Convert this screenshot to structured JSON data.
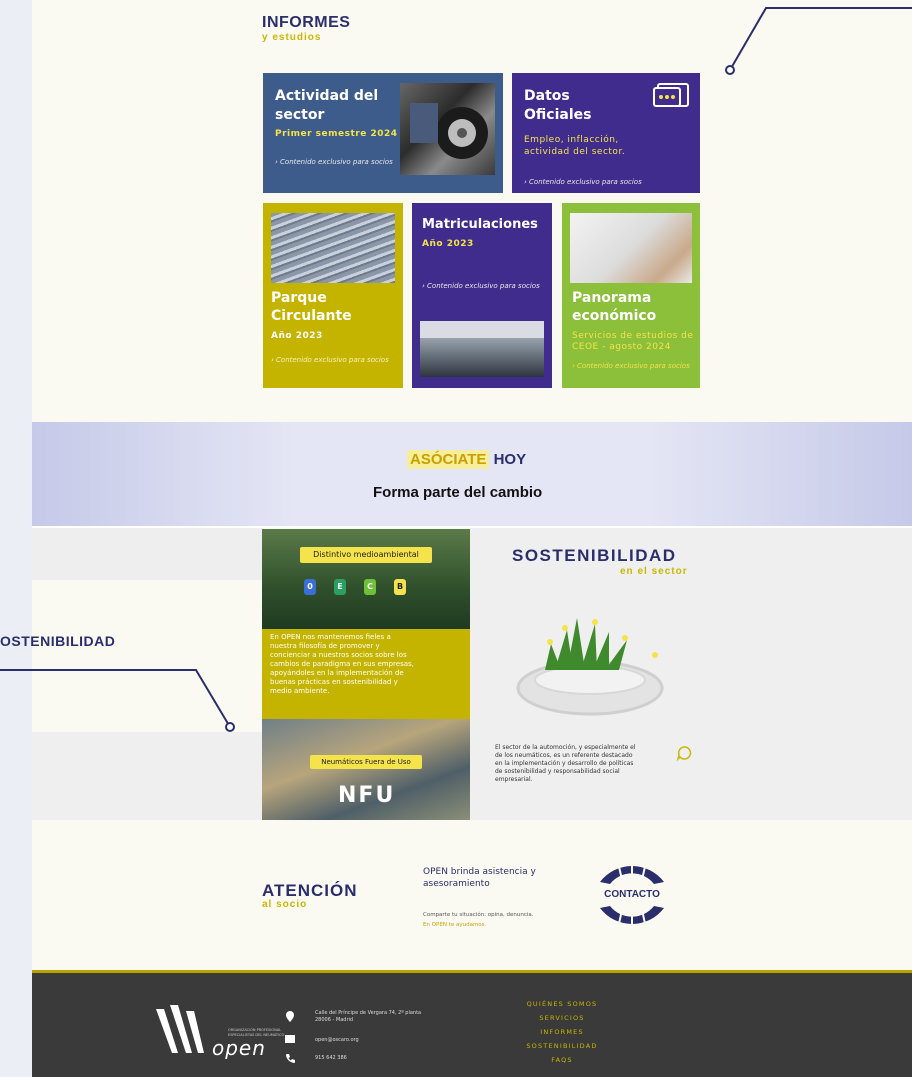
{
  "informes": {
    "title": "INFORMES",
    "subtitle": "y estudios",
    "cards": [
      {
        "title_l1": "Actividad del",
        "title_l2": "sector",
        "period": "Primer semestre 2024",
        "exclusive": "› Contenido exclusivo para socios"
      },
      {
        "title_l1": "Datos",
        "title_l2": "Oficiales",
        "desc_l1": "Empleo, inflacción,",
        "desc_l2": "actividad del sector.",
        "exclusive": "› Contenido exclusivo para socios"
      },
      {
        "title_l1": "Parque",
        "title_l2": "Circulante",
        "period": "Año 2023",
        "exclusive": "› Contenido exclusivo para socios"
      },
      {
        "title": "Matriculaciones",
        "period": "Año 2023",
        "exclusive": "› Contenido exclusivo para socios"
      },
      {
        "title_l1": "Panorama",
        "title_l2": "económico",
        "desc_l1": "Servicios de estudios de",
        "desc_l2": "CEOE - agosto 2024",
        "exclusive": "› Contenido exclusivo para socios"
      }
    ]
  },
  "asociate": {
    "highlight": "ASÓCIATE",
    "rest": "HOY",
    "tagline": "Forma parte del cambio"
  },
  "sostenibilidad": {
    "side_label": "OSTENIBILIDAD",
    "title": "SOSTENIBILIDAD",
    "subtitle": "en el sector",
    "distintivo_label": "Distintivo medioambiental",
    "badges": [
      "0",
      "E",
      "C",
      "B"
    ],
    "panel_text_l1": "En OPEN nos mantenemos fieles a",
    "panel_text_l2": "nuestra filosofía de promover y",
    "panel_text_l3": "concienciar a nuestros socios sobre los",
    "panel_text_l4": "cambios de paradigma en sus empresas,",
    "panel_text_l5": "apoyándoles en la implementación de",
    "panel_text_l6": "buenas prácticas en sostenibilidad y",
    "panel_text_l7": "medio ambiente.",
    "nfu_label": "Neumáticos Fuera de Uso",
    "nfu_text": "NFU",
    "body_l1": "El sector de la automoción, y especialmente el",
    "body_l2": "de los neumáticos, es un referente destacado",
    "body_l3": "en la implementación y desarrollo de políticas",
    "body_l4": "de sostenibilidad y responsabilidad social",
    "body_l5": "empresarial."
  },
  "atencion": {
    "title": "ATENCIÓN",
    "subtitle": "al socio",
    "lead_l1": "OPEN brinda asistencia y",
    "lead_l2": "asesoramiento",
    "small_l1": "Comparte tu situación: opina, denuncia.",
    "small_l2": "En OPEN te ayudamos.",
    "contact_label": "CONTACTO"
  },
  "footer": {
    "logo_text": "open",
    "logo_small_l1": "ORGANIZACIÓN PROFESIONAL",
    "logo_small_l2": "ESPECIALISTAS DEL NEUMÁTICO",
    "address_l1": "Calle del Príncipe de Vergara 74, 2º planta",
    "address_l2": "28006 - Madrid",
    "email": "open@oscaro.org",
    "phone": "915 642 386",
    "links": [
      "QUIÉNES SOMOS",
      "SERVICIOS",
      "INFORMES",
      "SOSTENIBILIDAD",
      "FAQS"
    ]
  },
  "colors": {
    "navy": "#2a2e6b",
    "yellow": "#c9b700",
    "blue_card": "#3d5c8c",
    "purple_card": "#3f2c8c",
    "mustard_card": "#c4b400",
    "green_card": "#8cbf3a"
  }
}
